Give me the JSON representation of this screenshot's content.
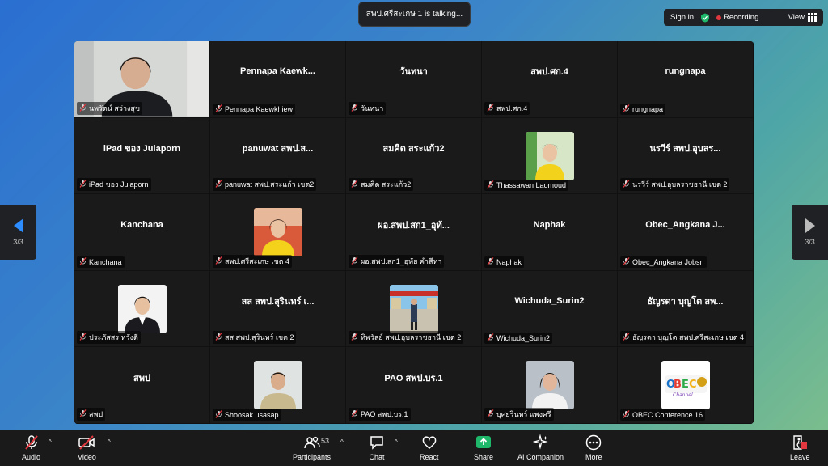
{
  "talking_indicator": "สพป.ศรีสะเกษ 1 is talking...",
  "top_bar": {
    "sign_in": "Sign in",
    "recording": "Recording",
    "view": "View"
  },
  "pager": {
    "left": "3/3",
    "right": "3/3"
  },
  "tiles": [
    {
      "label": "นพรัตน์ สว่างสุข",
      "center": "",
      "avatar": "video"
    },
    {
      "label": "Pennapa Kaewkhiew",
      "center": "Pennapa  Kaewk...",
      "avatar": ""
    },
    {
      "label": "วันทนา",
      "center": "วันทนา",
      "avatar": ""
    },
    {
      "label": "สพป.ศก.4",
      "center": "สพป.ศก.4",
      "avatar": ""
    },
    {
      "label": "rungnapa",
      "center": "rungnapa",
      "avatar": ""
    },
    {
      "label": "iPad ของ Julaporn",
      "center": "iPad ของ Julaporn",
      "avatar": ""
    },
    {
      "label": "panuwat สพป.สระแก้ว เขต2",
      "center": "panuwat สพป.ส...",
      "avatar": ""
    },
    {
      "label": "สมคิด สระแก้ว2",
      "center": "สมคิด สระแก้ว2",
      "avatar": ""
    },
    {
      "label": "Thassawan Laomoud",
      "center": "",
      "avatar": "yellow-woman"
    },
    {
      "label": "นรวีร์  สพป.อุบลราชธานี เขต 2",
      "center": "นรวีร์  สพป.อุบลร...",
      "avatar": ""
    },
    {
      "label": "Kanchana",
      "center": "Kanchana",
      "avatar": ""
    },
    {
      "label": "สพป.ศรีสะเกษ เขต 4",
      "center": "",
      "avatar": "yellow-woman-2"
    },
    {
      "label": "ผอ.สพป.สก1_อุทัย คำสีหา",
      "center": "ผอ.สพป.สก1_อุทั...",
      "avatar": ""
    },
    {
      "label": "Naphak",
      "center": "Naphak",
      "avatar": ""
    },
    {
      "label": "Obec_Angkana Jobsri",
      "center": "Obec_Angkana  J...",
      "avatar": ""
    },
    {
      "label": "ประภัสสร หวังดี",
      "center": "",
      "avatar": "suit-woman"
    },
    {
      "label": "สส สพป.สุรินทร์ เขต 2",
      "center": "สส สพป.สุรินทร์ เ...",
      "avatar": ""
    },
    {
      "label": "ทิพวัลย์ สพป.อุบลราชธานี เขต 2",
      "center": "",
      "avatar": "outdoor"
    },
    {
      "label": "Wichuda_Surin2",
      "center": "Wichuda_Surin2",
      "avatar": ""
    },
    {
      "label": "ธัญรดา บุญโต สพป.ศรีสะเกษ เขต 4",
      "center": "ธัญรดา  บุญโต สพ...",
      "avatar": ""
    },
    {
      "label": "สพป",
      "center": "สพป",
      "avatar": ""
    },
    {
      "label": "Shoosak usasap",
      "center": "",
      "avatar": "man"
    },
    {
      "label": "PAO สพป.บร.1",
      "center": "PAO สพป.บร.1",
      "avatar": ""
    },
    {
      "label": "บุศยรินทร์ แพงศรี",
      "center": "",
      "avatar": "woman-dark"
    },
    {
      "label": "OBEC Conference 16",
      "center": "",
      "avatar": "obec"
    }
  ],
  "toolbar": {
    "audio": "Audio",
    "video": "Video",
    "participants": "Participants",
    "participants_count": "53",
    "chat": "Chat",
    "react": "React",
    "share": "Share",
    "ai_companion": "AI Companion",
    "more": "More",
    "leave": "Leave"
  },
  "colors": {
    "share_green": "#1fb86b",
    "leave_red": "#e0383e",
    "accent_blue": "#2d8cff"
  }
}
